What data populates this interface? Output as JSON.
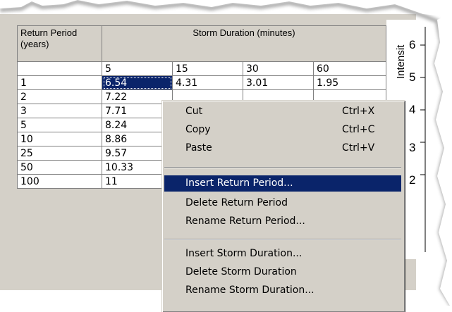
{
  "table": {
    "header_row_label": "Return Period\n(years)",
    "header_group_label": "Storm Duration (minutes)",
    "durations": [
      "5",
      "15",
      "30",
      "60"
    ],
    "rows": [
      {
        "period": "1",
        "values": [
          "6.54",
          "4.31",
          "3.01",
          "1.95"
        ]
      },
      {
        "period": "2",
        "values": [
          "7.22",
          "",
          "",
          ""
        ]
      },
      {
        "period": "3",
        "values": [
          "7.71",
          "",
          "",
          ""
        ]
      },
      {
        "period": "5",
        "values": [
          "8.24",
          "",
          "",
          ""
        ]
      },
      {
        "period": "10",
        "values": [
          "8.86",
          "",
          "",
          ""
        ]
      },
      {
        "period": "25",
        "values": [
          "9.57",
          "",
          "",
          ""
        ]
      },
      {
        "period": "50",
        "values": [
          "10.33",
          "",
          "",
          ""
        ]
      },
      {
        "period": "100",
        "values": [
          "11",
          "",
          "",
          ""
        ]
      }
    ]
  },
  "chart": {
    "ylabel": "Intensit",
    "ticks": [
      "6",
      "5",
      "4",
      "3",
      "2"
    ]
  },
  "context_menu": {
    "cut": {
      "label": "Cut",
      "shortcut": "Ctrl+X"
    },
    "copy": {
      "label": "Copy",
      "shortcut": "Ctrl+C"
    },
    "paste": {
      "label": "Paste",
      "shortcut": "Ctrl+V"
    },
    "insert_return_period": "Insert Return Period...",
    "delete_return_period": "Delete Return Period",
    "rename_return_period": "Rename Return Period...",
    "insert_storm_duration": "Insert Storm Duration...",
    "delete_storm_duration": "Delete Storm Duration",
    "rename_storm_duration": "Rename Storm Duration..."
  },
  "colors": {
    "selection": "#0a246a",
    "dialog_bg": "#d4d0c8"
  }
}
